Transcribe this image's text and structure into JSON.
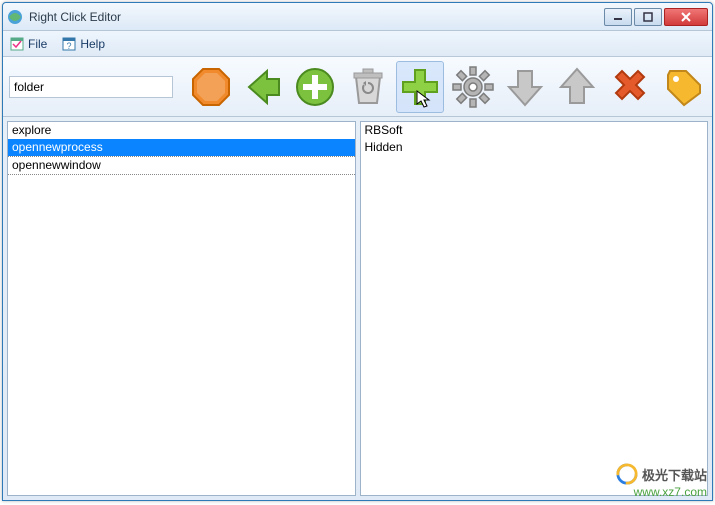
{
  "app": {
    "title": "Right Click Editor"
  },
  "menu": {
    "file": "File",
    "help": "Help"
  },
  "search": {
    "value": "folder"
  },
  "toolbarIcons": {
    "stop": "stop-icon",
    "back": "back-icon",
    "add": "add-icon",
    "recycle": "recycle-icon",
    "plus": "plus-icon",
    "settings": "settings-icon",
    "down": "down-icon",
    "up": "up-icon",
    "delete": "delete-icon",
    "tag": "tag-icon"
  },
  "leftList": {
    "items": [
      "explore",
      "opennewprocess",
      "opennewwindow"
    ],
    "selected": "opennewprocess"
  },
  "rightList": {
    "items": [
      "RBSoft",
      "Hidden"
    ]
  },
  "watermark": {
    "cn": "极光下载站",
    "url": "www.xz7.com"
  }
}
